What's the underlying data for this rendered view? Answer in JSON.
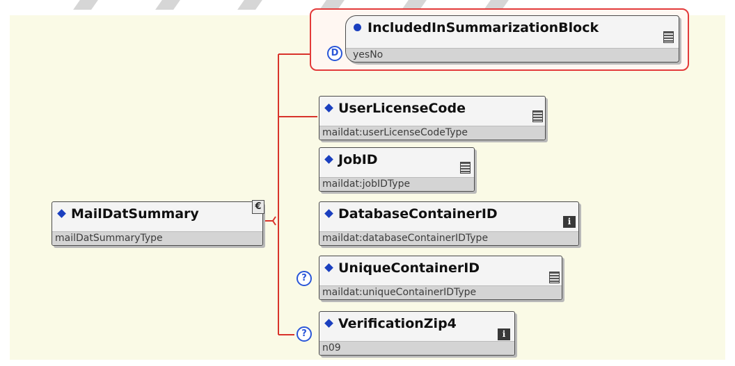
{
  "root": {
    "name": "MailDatSummary",
    "type": "mailDatSummaryType",
    "compositor_glyph": "€"
  },
  "children": [
    {
      "name": "IncludedInSummarizationBlock",
      "type": "yesNo",
      "badge": "D"
    },
    {
      "name": "UserLicenseCode",
      "type": "maildat:userLicenseCodeType"
    },
    {
      "name": "JobID",
      "type": "maildat:jobIDType"
    },
    {
      "name": "DatabaseContainerID",
      "type": "maildat:databaseContainerIDType",
      "info": "i"
    },
    {
      "name": "UniqueContainerID",
      "type": "maildat:uniqueContainerIDType",
      "badge": "?"
    },
    {
      "name": "VerificationZip4",
      "type": "n09",
      "badge": "?",
      "info": "i"
    }
  ],
  "colors": {
    "connector": "#d8322a",
    "choice_border": "#e33a3a",
    "diamond": "#1a3fbf",
    "badge": "#2a56d8",
    "canvas": "#fafae6"
  },
  "icons": [
    "diamond-icon",
    "documentation-icon",
    "info-icon",
    "optional-icon",
    "default-icon",
    "sequence-compositor-icon"
  ]
}
